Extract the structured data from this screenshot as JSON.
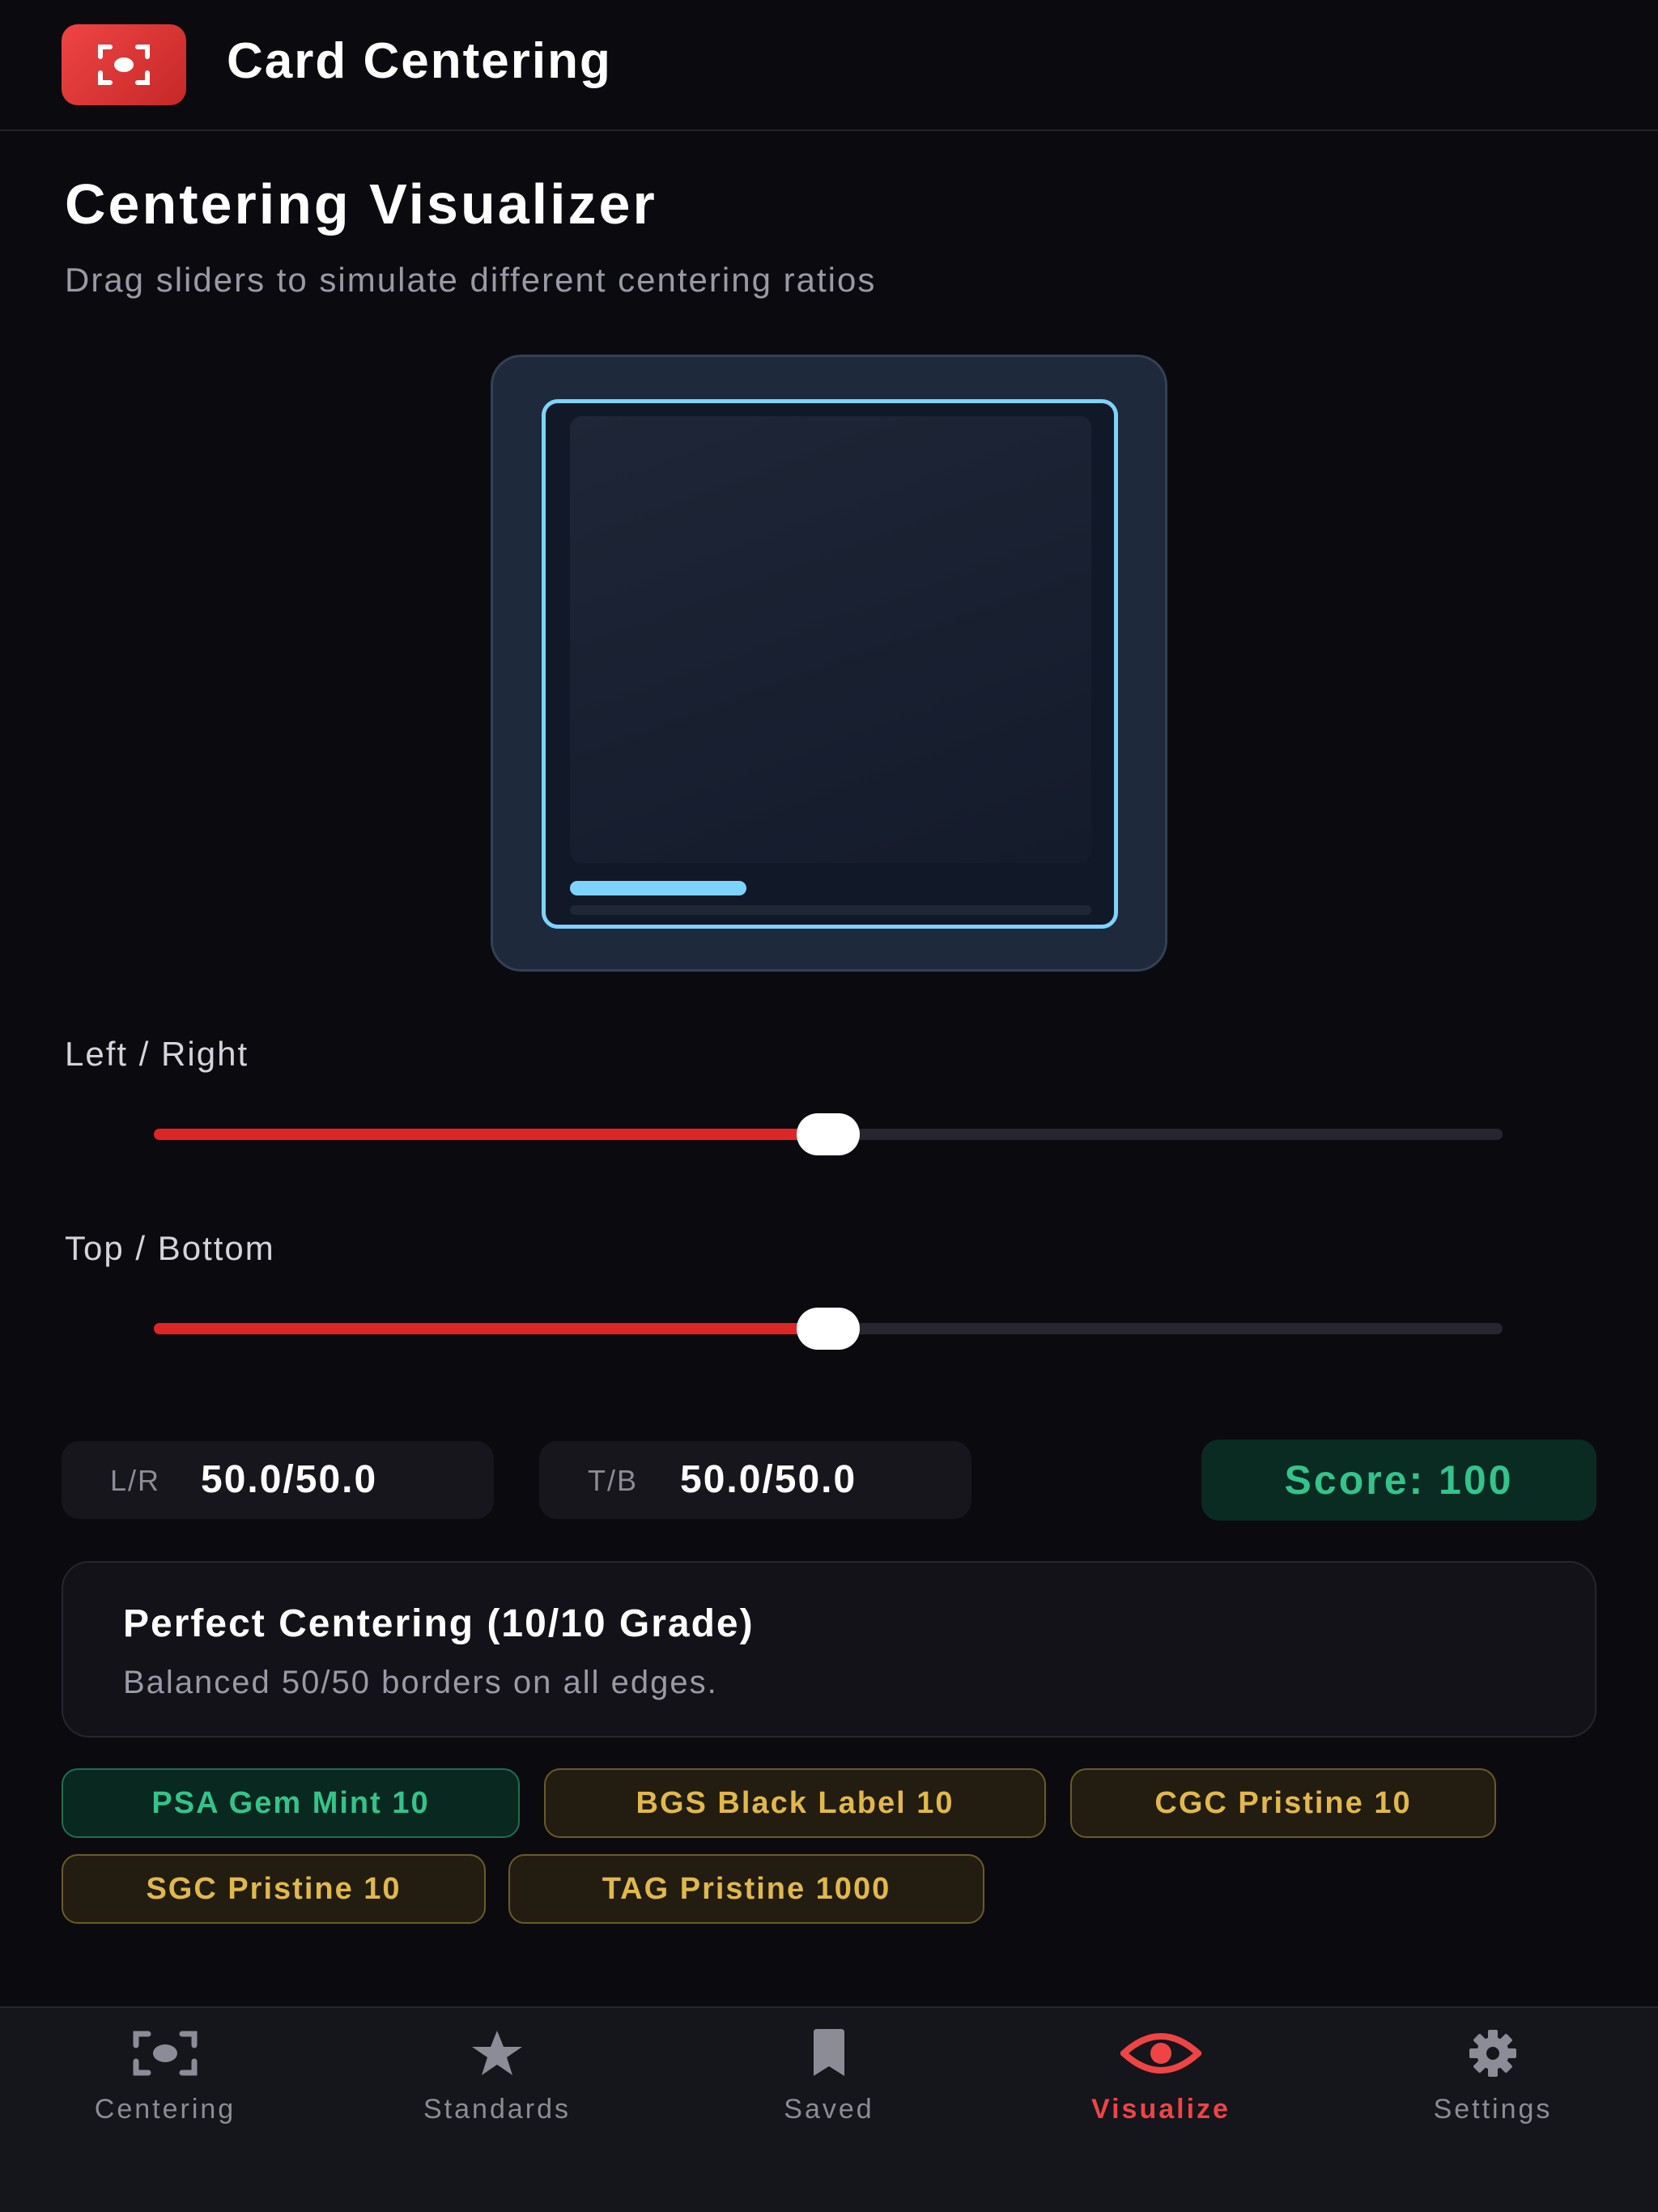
{
  "header": {
    "app_title": "Card Centering",
    "logo_icon": "focus-camera-icon",
    "accent": "#dc2626"
  },
  "page": {
    "title": "Centering Visualizer",
    "subtitle": "Drag sliders to simulate different centering ratios"
  },
  "preview": {
    "frame_color": "#7dd3fc"
  },
  "sliders": [
    {
      "label": "Left / Right",
      "value_percent": 50
    },
    {
      "label": "Top / Bottom",
      "value_percent": 50
    }
  ],
  "stats": {
    "lr_key": "L/R",
    "lr_value": "50.0/50.0",
    "tb_key": "T/B",
    "tb_value": "50.0/50.0",
    "score": "Score: 100",
    "score_color": "#34c48b"
  },
  "grade": {
    "title": "Perfect Centering (10/10 Grade)",
    "description": "Balanced 50/50 borders on all edges."
  },
  "badges": [
    {
      "label": "PSA Gem Mint 10",
      "status": "green"
    },
    {
      "label": "BGS Black Label 10",
      "status": "gold"
    },
    {
      "label": "CGC Pristine 10",
      "status": "gold"
    },
    {
      "label": "SGC Pristine 10",
      "status": "gold"
    },
    {
      "label": "TAG Pristine 1000",
      "status": "gold"
    }
  ],
  "nav": {
    "items": [
      {
        "label": "Centering",
        "icon": "focus-camera-icon"
      },
      {
        "label": "Standards",
        "icon": "star-icon"
      },
      {
        "label": "Saved",
        "icon": "bookmark-icon"
      },
      {
        "label": "Visualize",
        "icon": "eye-icon",
        "active": true
      },
      {
        "label": "Settings",
        "icon": "gear-icon"
      }
    ]
  }
}
